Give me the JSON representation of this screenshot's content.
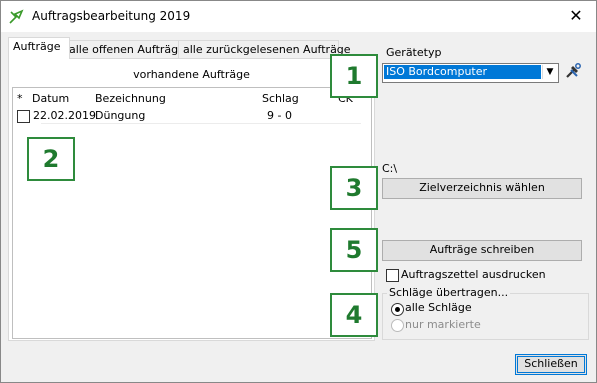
{
  "window": {
    "title": "Auftragsbearbeitung 2019",
    "close_glyph": "✕"
  },
  "tabs": [
    {
      "label": "Aufträge",
      "active": true
    },
    {
      "label": "alle offenen Aufträge",
      "active": false
    },
    {
      "label": "alle zurückgelesenen Aufträge",
      "active": false
    }
  ],
  "orders": {
    "group_title": "vorhandene Aufträge",
    "columns": [
      "*",
      "Datum",
      "Bezeichnung",
      "Schlag",
      "CK"
    ],
    "rows": [
      {
        "checked": false,
        "datum": "22.02.2019",
        "bezeichnung": "Düngung",
        "schlag": "9 - 0",
        "ck": ""
      }
    ]
  },
  "badges": [
    "1",
    "2",
    "3",
    "4",
    "5"
  ],
  "device": {
    "label": "Gerätetyp",
    "selected": "ISO Bordcomputer",
    "dropdown_glyph": "▼",
    "tool_icon": "wrench-hammer-icon"
  },
  "target": {
    "path": "C:\\",
    "choose_button": "Zielverzeichnis wählen"
  },
  "write_button": "Aufträge schreiben",
  "print_slip": {
    "label": "Auftragszettel ausdrucken",
    "checked": false
  },
  "transfer": {
    "legend": "Schläge übertragen...",
    "options": [
      {
        "label": "alle Schläge",
        "selected": true,
        "enabled": true
      },
      {
        "label": "nur markierte",
        "selected": false,
        "enabled": false
      }
    ]
  },
  "close_button": "Schließen",
  "colors": {
    "accent": "#0078d7",
    "badge_green": "#2e8b3c"
  }
}
